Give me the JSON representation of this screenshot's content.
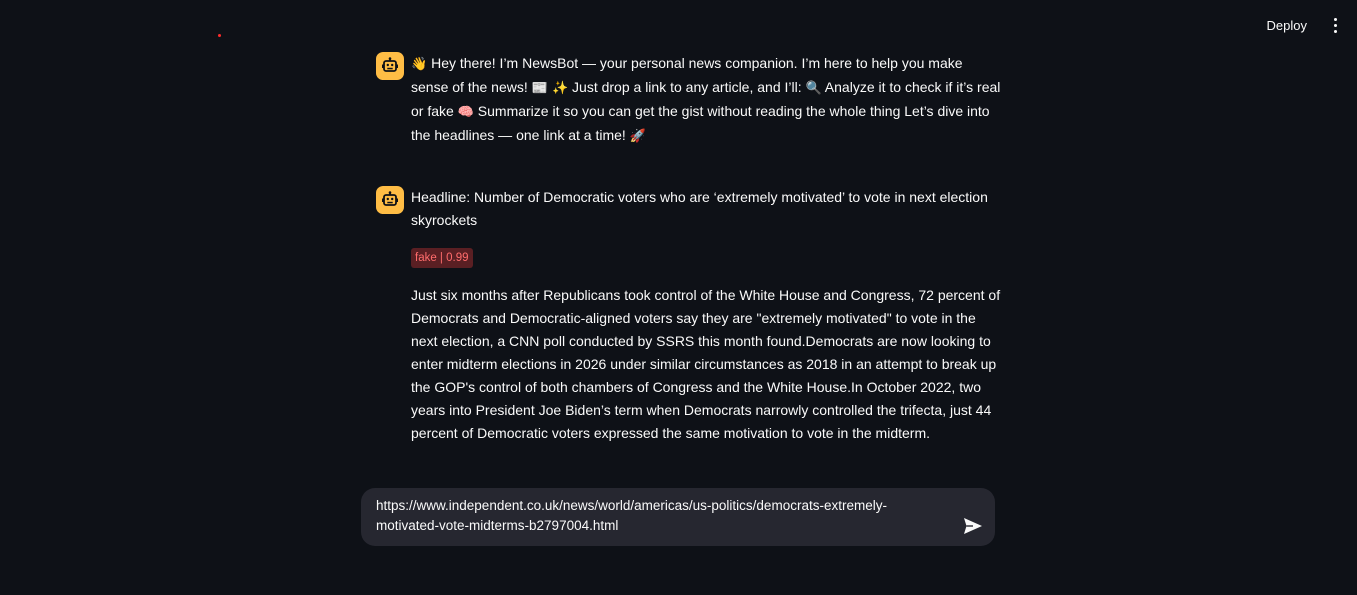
{
  "header": {
    "deploy_label": "Deploy",
    "menu_icon": "vertical-dots-icon"
  },
  "messages": [
    {
      "role": "assistant",
      "avatar_icon": "robot-face-icon",
      "intro_parts": {
        "wave": "👋",
        "line1": " Hey there! I’m NewsBot — your personal news companion. I’m here to help you make sense of the news! ",
        "newspaper": "📰",
        "sparkles": " ✨",
        "line2": " Just drop a link to any article, and I’ll: ",
        "magnifier": "🔍",
        "line3": " Analyze it to check if it’s real or fake ",
        "brain": "🧠",
        "line4": " Summarize it so you can get the gist without reading the whole thing Let’s dive into the headlines — one link at a time! ",
        "rocket": "🚀"
      }
    },
    {
      "role": "assistant",
      "avatar_icon": "robot-face-icon",
      "headline": "Headline: Number of Democratic voters who are ‘extremely motivated’ to vote in next election skyrockets",
      "badge": "fake | 0.99",
      "summary": "Just six months after Republicans took control of the White House and Congress, 72 percent of Democrats and Democratic-aligned voters say they are \"extremely motivated\" to vote in the next election, a CNN poll conducted by SSRS this month found.Democrats are now looking to enter midterm elections in 2026 under similar circumstances as 2018 in an attempt to break up the GOP's control of both chambers of Congress and the White House.In October 2022, two years into President Joe Biden’s term when Democrats narrowly controlled the trifecta, just 44 percent of Democratic voters expressed the same motivation to vote in the midterm."
    }
  ],
  "chat_input": {
    "value": "https://www.independent.co.uk/news/world/americas/us-politics/democrats-extremely-motivated-vote-midterms-b2797004.html",
    "send_icon": "send-arrow-icon"
  },
  "colors": {
    "background": "#0e1117",
    "avatar": "#ffbd45",
    "badge_bg": "#5a1f23",
    "badge_text": "#ff6c6c",
    "input_bg": "#262730",
    "status_dot": "#ff2b2b"
  }
}
